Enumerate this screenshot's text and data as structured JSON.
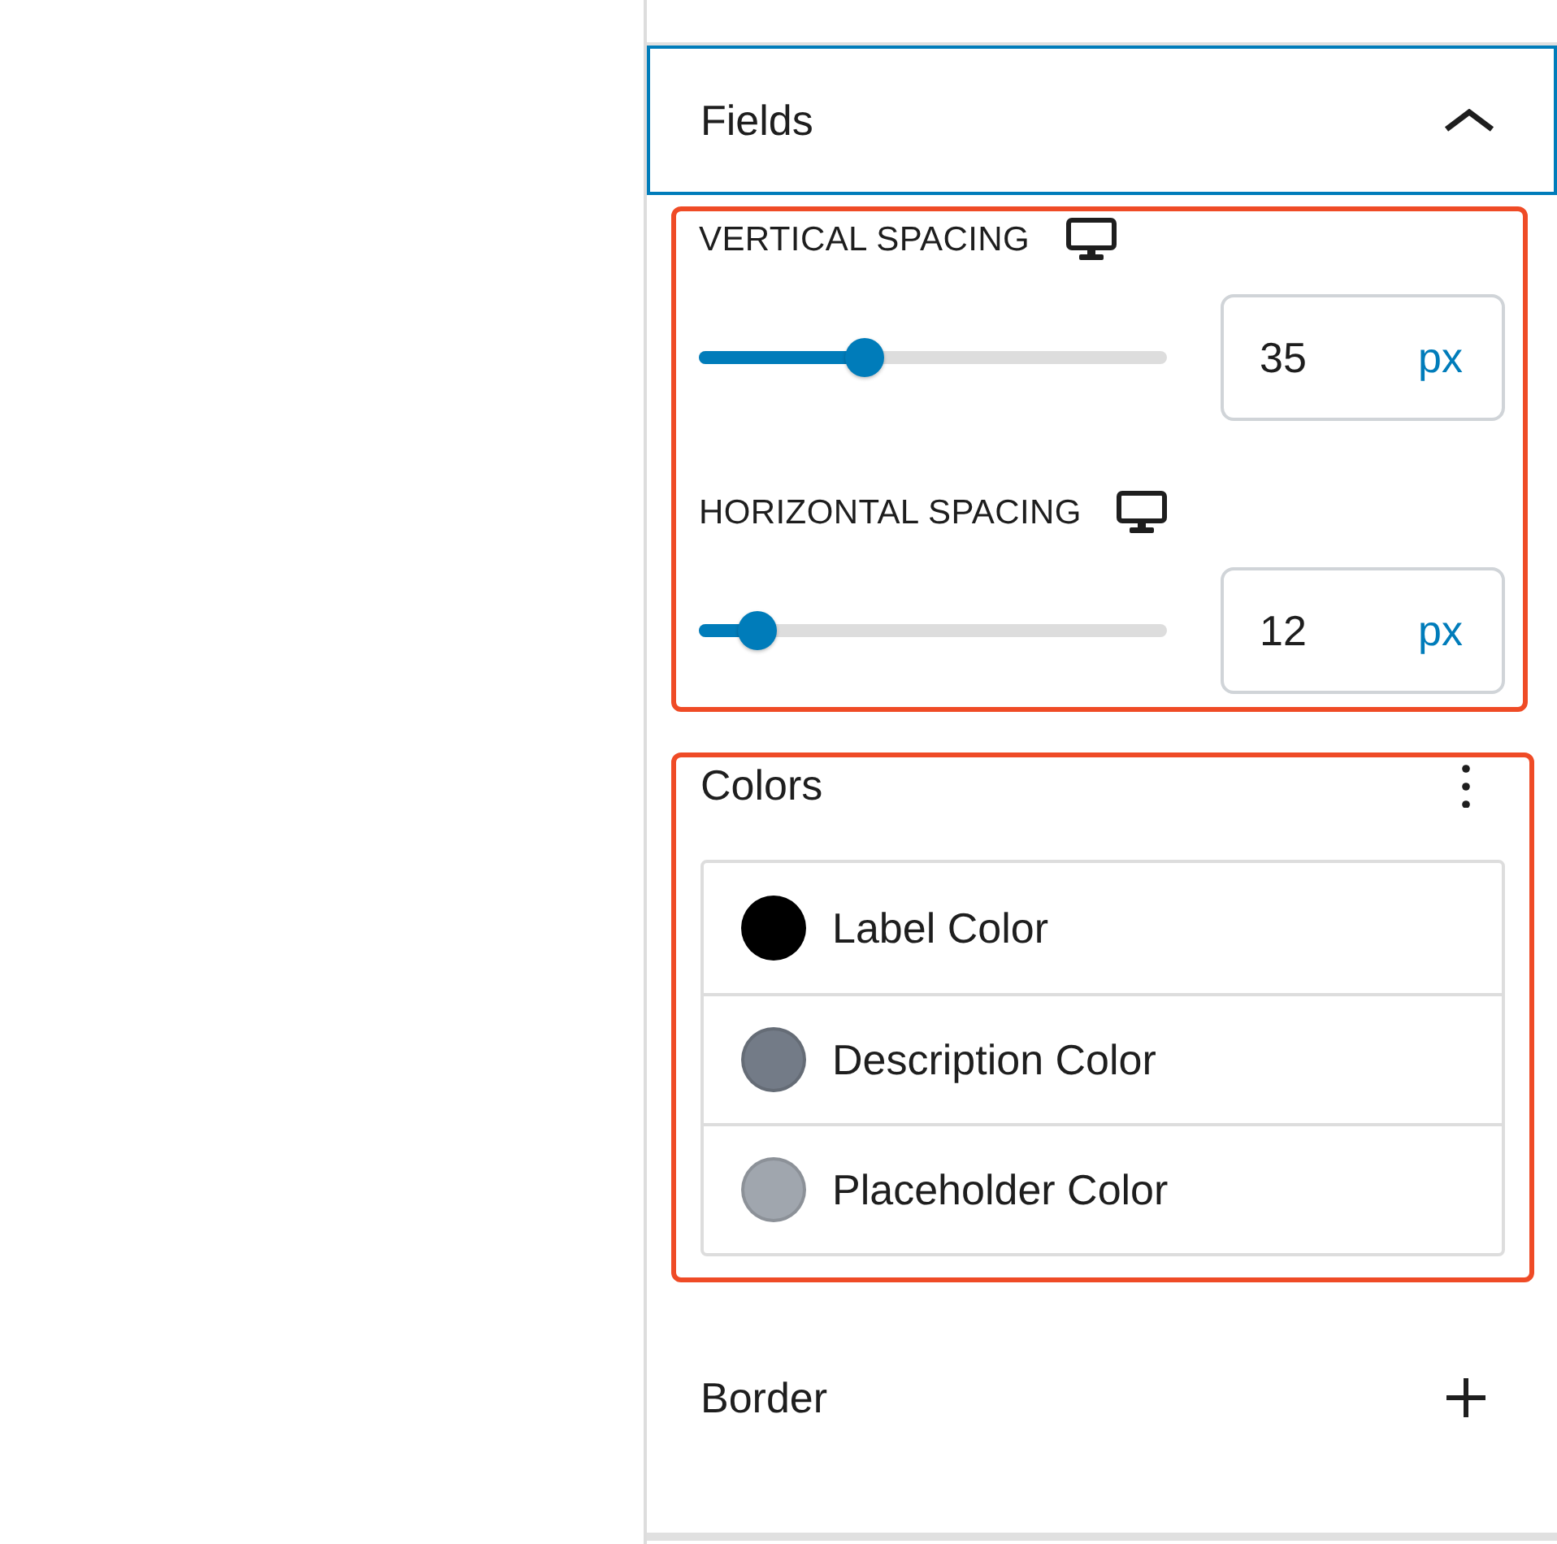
{
  "fields_panel": {
    "title": "Fields",
    "expanded": true,
    "focused": true
  },
  "spacing": {
    "highlighted": true,
    "controls": [
      {
        "label": "VERTICAL SPACING",
        "level": 0.354,
        "value": "35",
        "unit": "px"
      },
      {
        "label": "HORIZONTAL SPACING",
        "level": 0.125,
        "value": "12",
        "unit": "px"
      }
    ]
  },
  "colors": {
    "highlighted": true,
    "title": "Colors",
    "items": [
      {
        "label": "Label Color",
        "color": "#000000"
      },
      {
        "label": "Description Color",
        "color": "#737b87"
      },
      {
        "label": "Placeholder Color",
        "color": "#a0a6ae"
      }
    ]
  },
  "border_panel": {
    "title": "Border"
  }
}
